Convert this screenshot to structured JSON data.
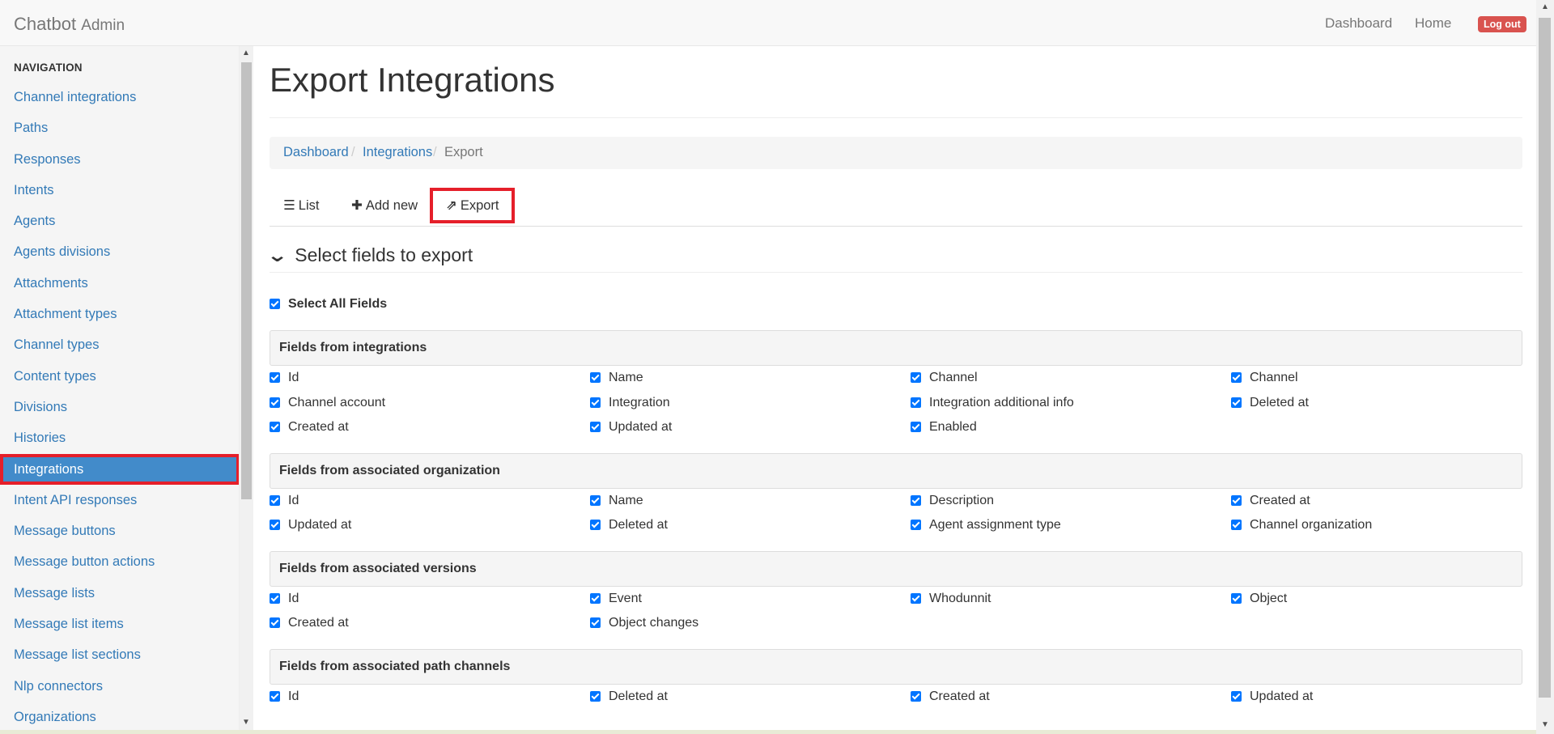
{
  "header": {
    "brand": "Chatbot",
    "brand_sub": "Admin",
    "nav": [
      "Dashboard",
      "Home"
    ],
    "logout": "Log out"
  },
  "sidebar": {
    "heading": "NAVIGATION",
    "items": [
      "Channel integrations",
      "Paths",
      "Responses",
      "Intents",
      "Agents",
      "Agents divisions",
      "Attachments",
      "Attachment types",
      "Channel types",
      "Content types",
      "Divisions",
      "Histories",
      "Integrations",
      "Intent API responses",
      "Message buttons",
      "Message button actions",
      "Message lists",
      "Message list items",
      "Message list sections",
      "Nlp connectors",
      "Organizations"
    ],
    "active": "Integrations"
  },
  "main": {
    "title": "Export Integrations",
    "breadcrumb": [
      "Dashboard",
      "Integrations",
      "Export"
    ],
    "tabs": [
      {
        "icon": "list-icon",
        "glyph": "☰",
        "label": "List"
      },
      {
        "icon": "plus-icon",
        "glyph": "✚",
        "label": "Add new"
      },
      {
        "icon": "export-icon",
        "glyph": "⇗",
        "label": "Export"
      }
    ],
    "section_title": "Select fields to export",
    "select_all_label": "Select All Fields",
    "groups": [
      {
        "title": "Fields from integrations",
        "fields": [
          "Id",
          "Name",
          "Channel",
          "Channel",
          "Channel account",
          "Integration",
          "Integration additional info",
          "Deleted at",
          "Created at",
          "Updated at",
          "Enabled"
        ]
      },
      {
        "title": "Fields from associated organization",
        "fields": [
          "Id",
          "Name",
          "Description",
          "Created at",
          "Updated at",
          "Deleted at",
          "Agent assignment type",
          "Channel organization"
        ]
      },
      {
        "title": "Fields from associated versions",
        "fields": [
          "Id",
          "Event",
          "Whodunnit",
          "Object",
          "Created at",
          "Object changes"
        ]
      },
      {
        "title": "Fields from associated path channels",
        "fields": [
          "Id",
          "Deleted at",
          "Created at",
          "Updated at"
        ]
      }
    ]
  },
  "colors": {
    "link": "#337ab7",
    "active_nav": "#428bca",
    "highlight_border": "#e51f2a",
    "logout": "#d9534f",
    "checkbox": "#0075ff"
  }
}
